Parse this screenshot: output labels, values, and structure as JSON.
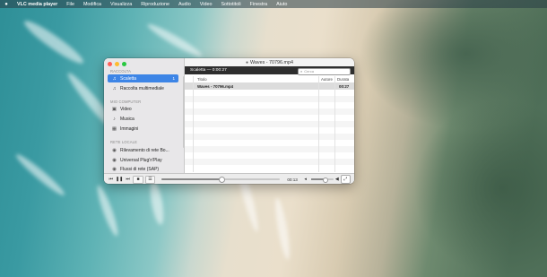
{
  "menubar": {
    "apple_icon": "",
    "app_name": "VLC media player",
    "items": [
      "File",
      "Modifica",
      "Visualizza",
      "Riproduzione",
      "Audio",
      "Video",
      "Sottotitoli",
      "Finestra",
      "Aiuto"
    ]
  },
  "window": {
    "title": "Waves - 70796.mp4",
    "title_icon": "document-icon"
  },
  "sidebar": {
    "section_raccolta": "RACCOLTA",
    "scaletta_label": "Scaletta",
    "scaletta_count": "1",
    "raccolta_multimediale_label": "Raccolta multimediale",
    "section_mio_computer": "MIO COMPUTER",
    "video_label": "Video",
    "musica_label": "Musica",
    "immagini_label": "Immagini",
    "section_rete_locale": "RETE LOCALE",
    "rilevamento_label": "Rilevamento di rete Bo...",
    "upnp_label": "Universal Plug'n'Play",
    "flussi_label": "Flussi di rete (SAP)"
  },
  "playlist": {
    "header_title": "Scaletta — 0:00:27",
    "search_placeholder": "Cerca",
    "columns": {
      "title": "Titolo",
      "author": "Autore",
      "duration": "Durata"
    },
    "rows": [
      {
        "title": "Waves - 70796.mp4",
        "author": "",
        "duration": "00:27"
      }
    ]
  },
  "controls": {
    "elapsed": "00:13",
    "progress_fraction": 0.5,
    "volume_fraction": 0.6
  },
  "colors": {
    "selection_blue": "#3d85e6",
    "playlist_header": "#2e2e2e"
  }
}
